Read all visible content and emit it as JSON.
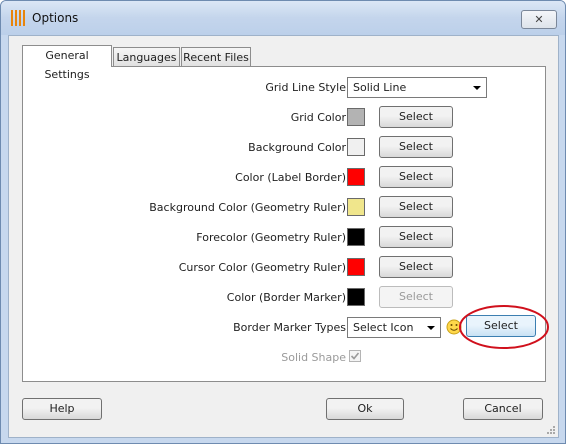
{
  "window": {
    "title": "Options",
    "close_glyph": "✕"
  },
  "tabs": [
    {
      "label": "General Settings"
    },
    {
      "label": "Languages"
    },
    {
      "label": "Recent Files"
    }
  ],
  "general": {
    "grid_line_style": {
      "label": "Grid Line Style",
      "value": "Solid Line"
    },
    "color_rows": [
      {
        "label": "Grid Color",
        "color": "#b3b3b3",
        "button": "Select"
      },
      {
        "label": "Background Color",
        "color": "#f0f0f0",
        "button": "Select"
      },
      {
        "label": "Color (Label Border)",
        "color": "#ff0000",
        "button": "Select"
      },
      {
        "label": "Background Color (Geometry Ruler)",
        "color": "#f0e68c",
        "button": "Select"
      },
      {
        "label": "Forecolor (Geometry Ruler)",
        "color": "#000000",
        "button": "Select"
      },
      {
        "label": "Cursor Color (Geometry Ruler)",
        "color": "#ff0000",
        "button": "Select"
      },
      {
        "label": "Color (Border Marker)",
        "color": "#000000",
        "button": "Select",
        "disabled": true
      }
    ],
    "border_marker_types": {
      "label": "Border Marker Types",
      "value": "Select Icon",
      "button": "Select",
      "icon": "smiley-icon"
    },
    "solid_shape": {
      "label": "Solid Shape",
      "checked": true,
      "disabled": true
    }
  },
  "footer": {
    "help": "Help",
    "ok": "Ok",
    "cancel": "Cancel"
  },
  "colors": {
    "annotation_ellipse": "#d0101c",
    "focus_button_border": "#3c7fb1"
  }
}
